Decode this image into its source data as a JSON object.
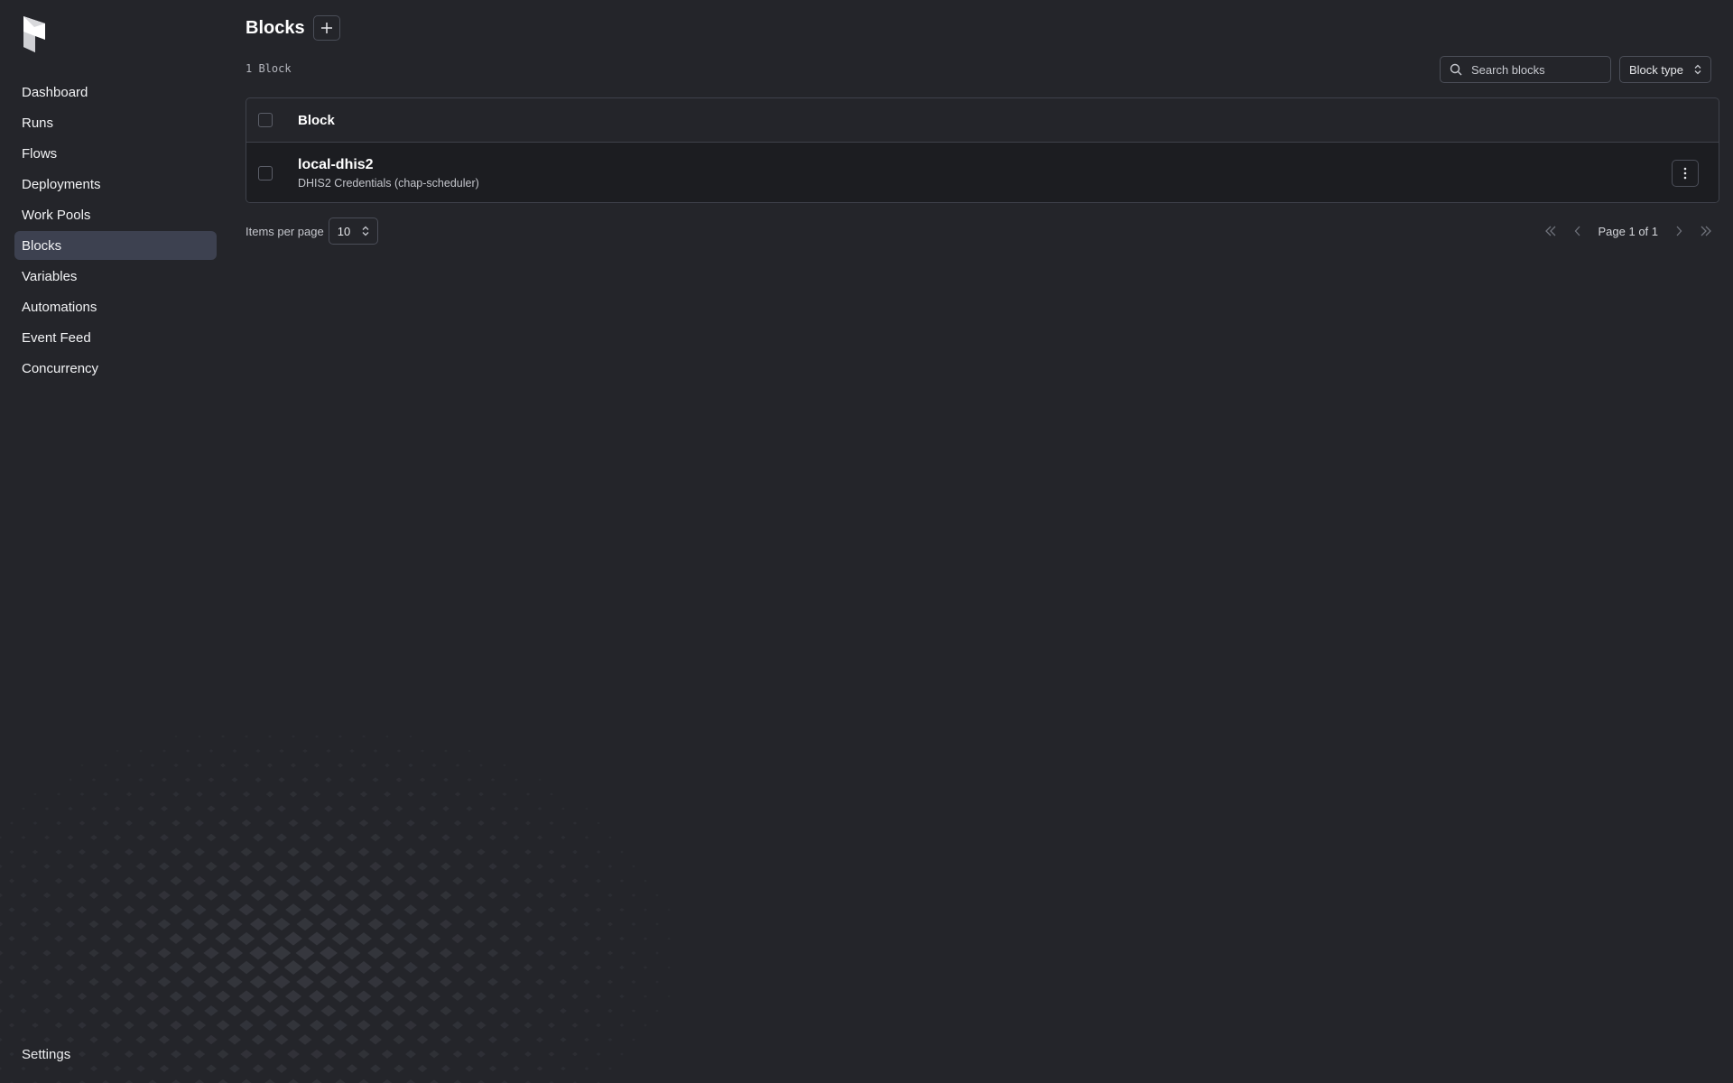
{
  "sidebar": {
    "items": [
      {
        "label": "Dashboard"
      },
      {
        "label": "Runs"
      },
      {
        "label": "Flows"
      },
      {
        "label": "Deployments"
      },
      {
        "label": "Work Pools"
      },
      {
        "label": "Blocks",
        "active": true
      },
      {
        "label": "Variables"
      },
      {
        "label": "Automations"
      },
      {
        "label": "Event Feed"
      },
      {
        "label": "Concurrency"
      }
    ],
    "settings_label": "Settings"
  },
  "header": {
    "title": "Blocks",
    "add_icon": "plus-icon"
  },
  "toolbar": {
    "count_label": "1 Block",
    "search_placeholder": "Search blocks",
    "block_type_label": "Block type"
  },
  "table": {
    "header_label": "Block",
    "rows": [
      {
        "name": "local-dhis2",
        "subtitle": "DHIS2 Credentials (chap-scheduler)"
      }
    ]
  },
  "pagination": {
    "items_per_page_label": "Items per page",
    "items_per_page_value": "10",
    "page_info": "Page 1 of 1"
  },
  "colors": {
    "background": "#24252a",
    "active_nav": "#3d4150",
    "row_bg": "#1c1d21"
  }
}
